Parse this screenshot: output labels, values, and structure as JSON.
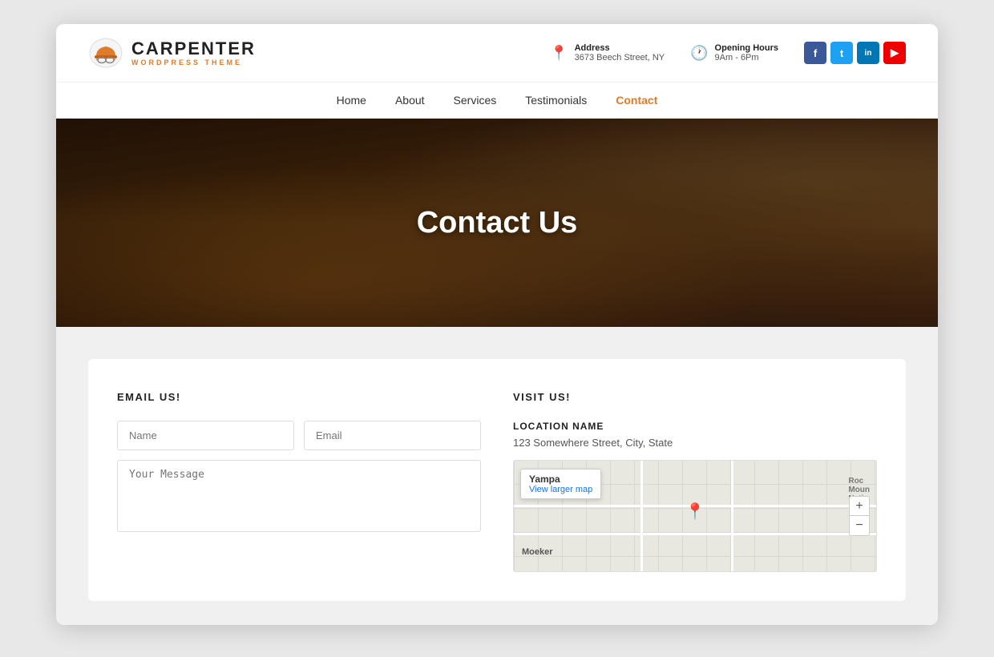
{
  "logo": {
    "title": "CARPENTER",
    "subtitle": "WORDPRESS THEME"
  },
  "header": {
    "address_label": "Address",
    "address_value": "3673 Beech Street, NY",
    "hours_label": "Opening Hours",
    "hours_value": "9Am - 6Pm"
  },
  "social": [
    {
      "name": "facebook",
      "label": "f",
      "class": "fb"
    },
    {
      "name": "twitter",
      "label": "t",
      "class": "tw"
    },
    {
      "name": "linkedin",
      "label": "in",
      "class": "li"
    },
    {
      "name": "youtube",
      "label": "▶",
      "class": "yt"
    }
  ],
  "nav": {
    "items": [
      {
        "label": "Home",
        "active": false
      },
      {
        "label": "About",
        "active": false
      },
      {
        "label": "Services",
        "active": false
      },
      {
        "label": "Testimonials",
        "active": false
      },
      {
        "label": "Contact",
        "active": true
      }
    ]
  },
  "hero": {
    "title": "Contact Us"
  },
  "email_section": {
    "heading": "EMAIL US!",
    "name_placeholder": "Name",
    "email_placeholder": "Email",
    "message_placeholder": "Your Message"
  },
  "visit_section": {
    "heading": "VISIT US!",
    "location_name": "LOCATION NAME",
    "location_address": "123 Somewhere Street, City, State",
    "map_tooltip_title": "Yampa",
    "map_tooltip_link": "View larger map",
    "map_label1": "Moeker",
    "map_label2": "Roc\nMoun\nNatio",
    "zoom_plus": "+",
    "zoom_minus": "−"
  }
}
